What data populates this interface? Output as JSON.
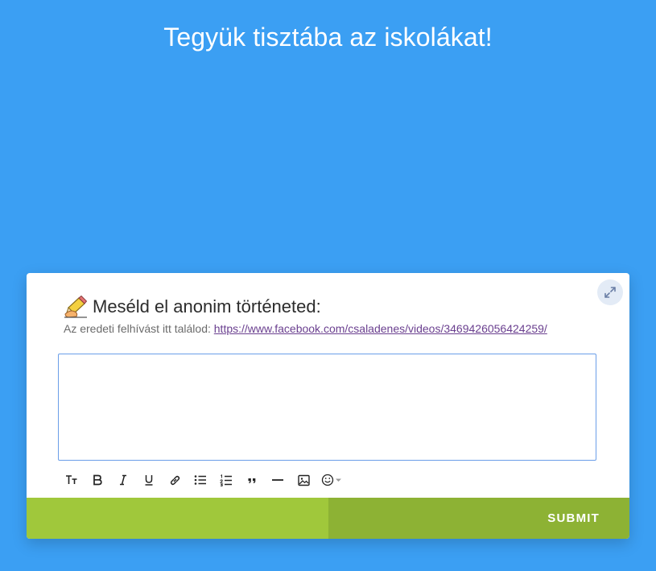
{
  "page": {
    "title": "Tegyük tisztába az iskolákat!",
    "background_color": "#3b9ff3"
  },
  "form": {
    "question_emoji": "writing-hand-icon",
    "question": "Meséld el anonim történeted:",
    "description_prefix": "Az eredeti felhívást itt találod:",
    "description_link": "https://www.facebook.com/csaladenes/videos/3469426056424259/",
    "answer_value": "",
    "progress_fraction": 0.5,
    "submit_label": "SUBMIT",
    "colors": {
      "progress": "#a0c83b",
      "submit": "#8db234",
      "link": "#6a3f8f",
      "field_border": "#6a9ee8"
    }
  },
  "toolbar": {
    "items": [
      "text-size-icon",
      "bold-icon",
      "italic-icon",
      "underline-icon",
      "link-icon",
      "bullet-list-icon",
      "numbered-list-icon",
      "quote-icon",
      "horizontal-rule-icon",
      "image-icon",
      "emoji-icon"
    ]
  }
}
